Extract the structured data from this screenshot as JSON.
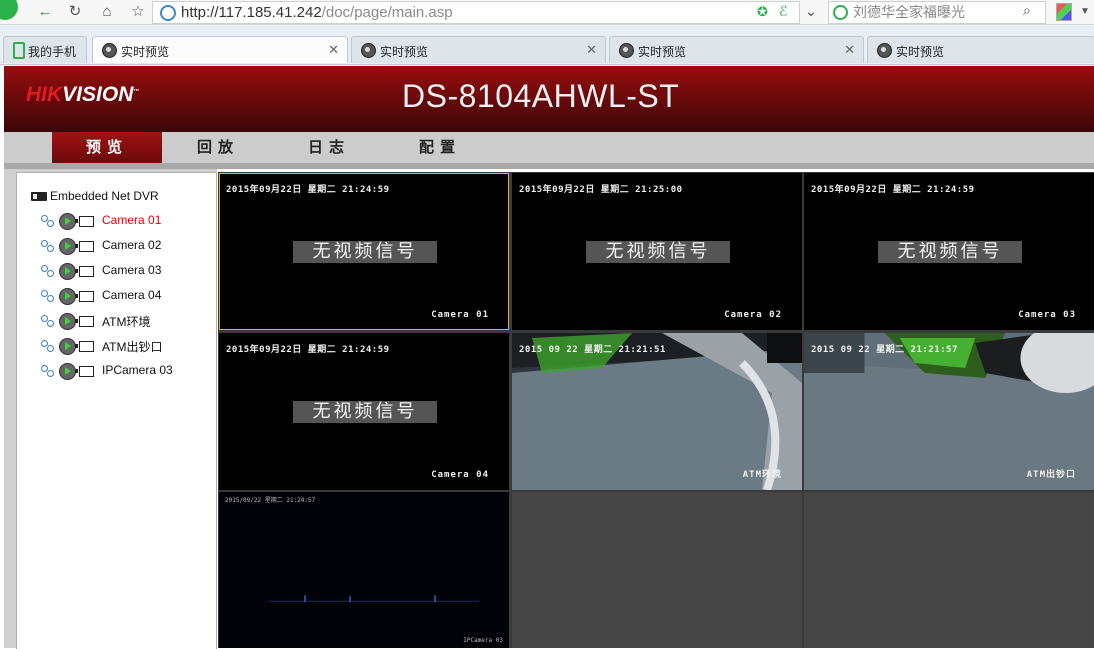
{
  "browser": {
    "url_host": "http://117.185.41.242",
    "url_path": "/doc/page/main.asp",
    "search_placeholder": "刘德华全家福曝光",
    "tabs": [
      {
        "label": "我的手机"
      },
      {
        "label": "实时预览",
        "active": true
      },
      {
        "label": "实时预览"
      },
      {
        "label": "实时预览"
      },
      {
        "label": "实时预览"
      }
    ]
  },
  "header": {
    "brand_hik": "HIK",
    "brand_vision": "VISION",
    "model": "DS-8104AHWL-ST"
  },
  "menu": [
    "预览",
    "回放",
    "日志",
    "配置"
  ],
  "tree": {
    "root": "Embedded Net DVR",
    "cameras": [
      "Camera 01",
      "Camera 02",
      "Camera 03",
      "Camera 04",
      "ATM环境",
      "ATM出钞口",
      "IPCamera 03"
    ],
    "selected_index": 0
  },
  "grid": {
    "no_signal": "无视频信号",
    "cells": [
      {
        "time": "2015年09月22日 星期二 21:24:59",
        "name": "Camera 01",
        "type": "nosignal"
      },
      {
        "time": "2015年09月22日 星期二 21:25:00",
        "name": "Camera 02",
        "type": "nosignal"
      },
      {
        "time": "2015年09月22日 星期二 21:24:59",
        "name": "Camera 03",
        "type": "nosignal"
      },
      {
        "time": "2015年09月22日 星期二 21:24:59",
        "name": "Camera 04",
        "type": "nosignal"
      },
      {
        "time": "2015 09 22 星期二 21:21:51",
        "name": "ATM环境",
        "type": "video"
      },
      {
        "time": "2015 09 22 星期二 21:21:57",
        "name": "ATM出钞口",
        "type": "video"
      },
      {
        "time": "2015/09/22 星期二 21:24:57",
        "name": "IPCamera 03",
        "type": "dark"
      },
      {
        "type": "empty"
      },
      {
        "type": "empty"
      }
    ]
  },
  "colors": {
    "brand_red": "#e01b22",
    "selected_text": "#e00000",
    "selected_border": "#d9b34a",
    "header_dark": "#3a0607"
  }
}
